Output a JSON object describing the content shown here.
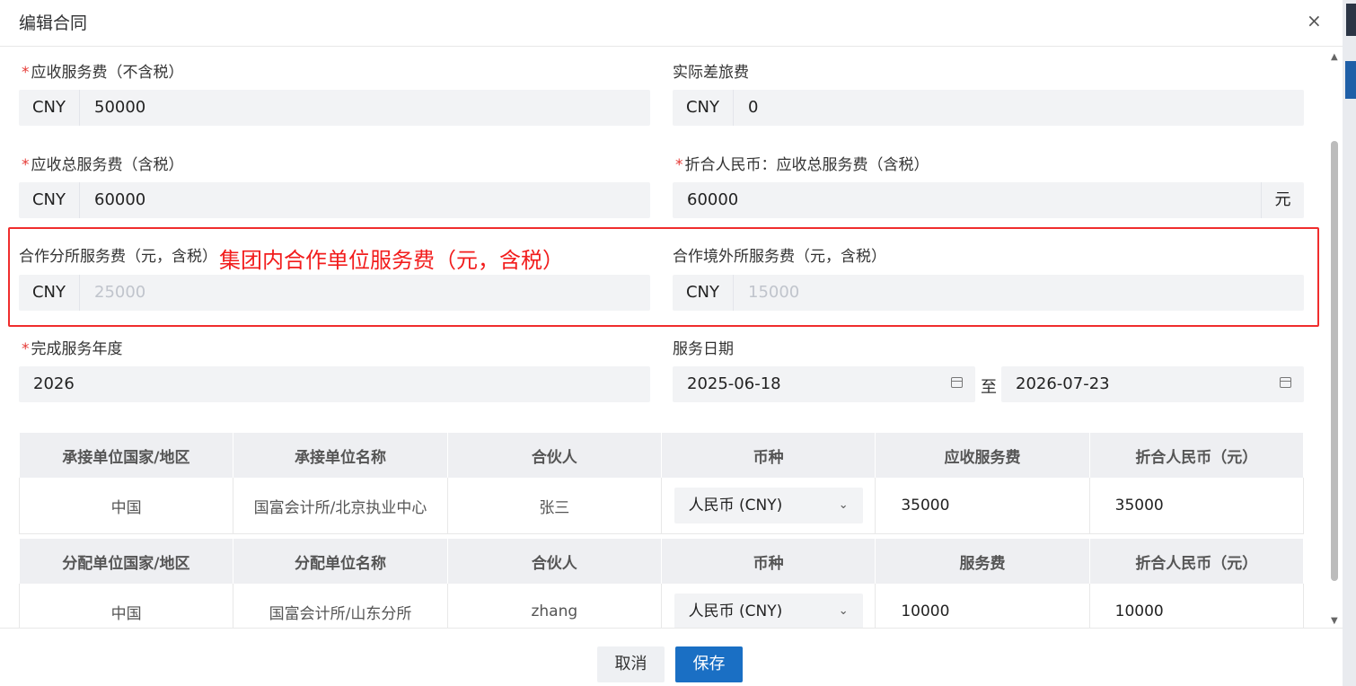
{
  "dialog": {
    "title": "编辑合同",
    "close_icon": "×"
  },
  "fields": {
    "receivable_fee": {
      "required": "*",
      "label": "应收服务费（不含税）",
      "prefix": "CNY",
      "value": "50000"
    },
    "travel_fee": {
      "label": "实际差旅费",
      "prefix": "CNY",
      "value": "0"
    },
    "total_fee": {
      "required": "*",
      "label": "应收总服务费（含税）",
      "prefix": "CNY",
      "value": "60000"
    },
    "rmb_total": {
      "required": "*",
      "label": "折合人民币：应收总服务费（含税）",
      "value": "60000",
      "suffix": "元"
    },
    "partner_branch_fee": {
      "label": "合作分所服务费（元，含税）",
      "prefix": "CNY",
      "placeholder": "25000"
    },
    "overseas_fee": {
      "label": "合作境外所服务费（元，含税）",
      "prefix": "CNY",
      "placeholder": "15000"
    },
    "service_year": {
      "required": "*",
      "label": "完成服务年度",
      "value": "2026"
    },
    "service_date": {
      "label": "服务日期",
      "start": "2025-06-18",
      "separator": "至",
      "end": "2026-07-23"
    }
  },
  "annotation": {
    "text": "集团内合作单位服务费（元，含税）",
    "color": "#f21d1d"
  },
  "contractor_table": {
    "headers": [
      "承接单位国家/地区",
      "承接单位名称",
      "合伙人",
      "币种",
      "应收服务费",
      "折合人民币（元）"
    ],
    "row": {
      "country": "中国",
      "name": "国富会计所/北京执业中心",
      "partner": "张三",
      "currency": "人民币 (CNY)",
      "fee": "35000",
      "rmb": "35000"
    }
  },
  "allocation_table": {
    "headers": [
      "分配单位国家/地区",
      "分配单位名称",
      "合伙人",
      "币种",
      "服务费",
      "折合人民币（元）"
    ],
    "row": {
      "country": "中国",
      "name": "国富会计所/山东分所",
      "partner": "zhang",
      "currency": "人民币 (CNY)",
      "fee": "10000",
      "rmb": "10000"
    }
  },
  "footer": {
    "cancel": "取消",
    "save": "保存"
  },
  "colors": {
    "primary": "#1a6fc4",
    "required": "#e53935",
    "highlight_border": "#f02d2d"
  }
}
